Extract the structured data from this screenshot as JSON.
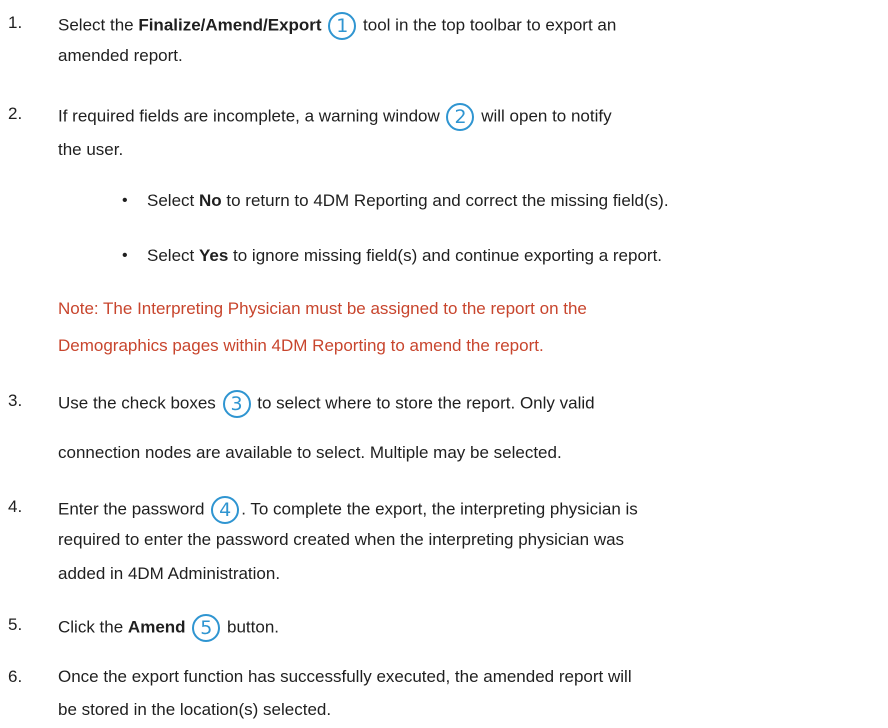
{
  "steps": [
    {
      "number": "1.",
      "lines": [
        {
          "before": "Select the ",
          "bold": "Finalize/Amend/Export",
          "callout": "1",
          "after": " tool in the top toolbar to export an"
        },
        {
          "text": "amended report."
        }
      ]
    },
    {
      "number": "2.",
      "lines": [
        {
          "before": "If required fields are incomplete, a warning window ",
          "callout": "2",
          "after": " will open to notify"
        },
        {
          "text": "the user."
        }
      ]
    },
    {
      "bullets": [
        {
          "before": "Select ",
          "bold": "No",
          "after": " to return to 4DM Reporting and correct the missing field(s)."
        },
        {
          "before": "Select ",
          "bold": "Yes",
          "after": " to ignore missing field(s) and continue exporting a report."
        }
      ]
    },
    {
      "note_lines": [
        "Note: The Interpreting Physician must be assigned to the report on the",
        "Demographics pages within 4DM Reporting to amend the report."
      ]
    },
    {
      "number": "3.",
      "lines": [
        {
          "before": "Use the check boxes ",
          "callout": "3",
          "after": " to select where to store the report. Only valid"
        },
        {
          "text": "connection nodes are available to select. Multiple may be selected."
        }
      ]
    },
    {
      "number": "4.",
      "lines": [
        {
          "before": "Enter the password ",
          "callout": "4",
          "after": ". To complete the export, the interpreting physician is"
        },
        {
          "text": "required to enter the password created when the interpreting physician was"
        },
        {
          "text": "added in 4DM Administration."
        }
      ]
    },
    {
      "number": "5.",
      "lines": [
        {
          "before": "Click the ",
          "bold": "Amend",
          "callout": "5",
          "after": " button."
        }
      ]
    },
    {
      "number": "6.",
      "lines": [
        {
          "text": "Once the export function has successfully executed, the amended report will"
        },
        {
          "text": "be stored in the location(s) selected."
        }
      ]
    }
  ],
  "bullet_symbol": "•",
  "colors": {
    "text": "#1f1f1f",
    "callout": "#2f95d1",
    "note": "#c8452d"
  }
}
